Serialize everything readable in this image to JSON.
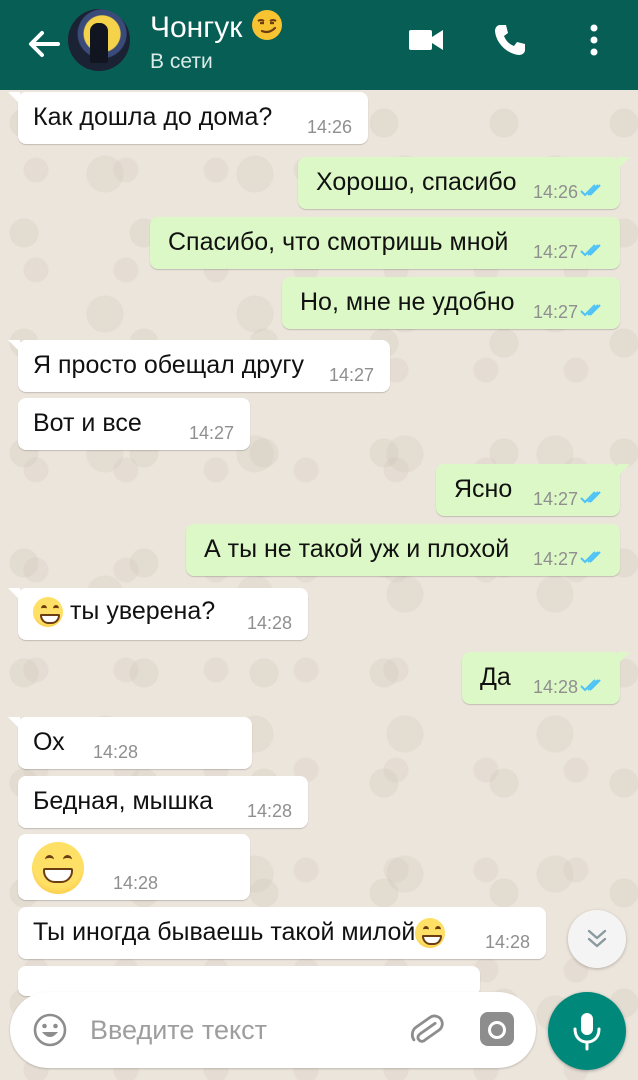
{
  "header": {
    "contact_name": "Чонгук",
    "contact_emoji": "smirking-face-emoji",
    "status": "В сети",
    "color": "#075e54"
  },
  "messages": [
    {
      "direction": "in",
      "text": "Как дошла до дома?",
      "time": "14:26"
    },
    {
      "direction": "out",
      "text": "Хорошо, спасибо",
      "time": "14:26",
      "read": true
    },
    {
      "direction": "out",
      "text": "Спасибо, что смотришь мной",
      "time": "14:27",
      "read": true
    },
    {
      "direction": "out",
      "text": "Но, мне не удобно",
      "time": "14:27",
      "read": true
    },
    {
      "direction": "in",
      "text": "Я просто обещал другу",
      "time": "14:27"
    },
    {
      "direction": "in",
      "text": "Вот и все",
      "time": "14:27"
    },
    {
      "direction": "out",
      "text": "Ясно",
      "time": "14:27",
      "read": true
    },
    {
      "direction": "out",
      "text": "А ты не такой уж и плохой",
      "time": "14:27",
      "read": true
    },
    {
      "direction": "in",
      "text": "ты уверена?",
      "time": "14:28",
      "emoji": "grinning-face-emoji"
    },
    {
      "direction": "out",
      "text": "Да",
      "time": "14:28",
      "read": true
    },
    {
      "direction": "in",
      "text": "Ох",
      "time": "14:28"
    },
    {
      "direction": "in",
      "text": "Бедная, мышка",
      "time": "14:28"
    },
    {
      "direction": "in",
      "text": "",
      "time": "14:28",
      "emoji": "grinning-face-emoji"
    },
    {
      "direction": "in",
      "text": "Ты иногда бываешь такой милой",
      "time": "14:28",
      "emoji": "grinning-face-emoji"
    }
  ],
  "input": {
    "placeholder": "Введите текст",
    "value": ""
  },
  "colors": {
    "incoming_bubble": "#ffffff",
    "outgoing_bubble": "#dcf8c6",
    "read_ticks": "#4fc3f7",
    "mic_button": "#00897b"
  }
}
